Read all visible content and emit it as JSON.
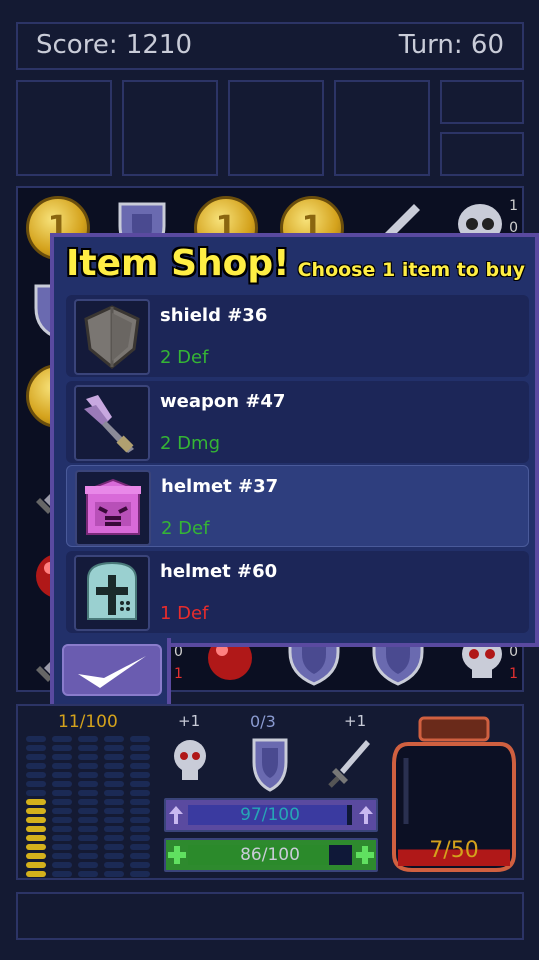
{
  "header": {
    "score": "Score: 1210",
    "turn": "Turn: 60"
  },
  "board": {
    "side_counts": [
      "1",
      "0",
      "0",
      "1",
      "0",
      "1"
    ]
  },
  "shop": {
    "title": "Item Shop!",
    "subtitle": "Choose 1 item to buy",
    "items": [
      {
        "name": "shield #36",
        "stat": "2 Def",
        "icon": "shield-icon",
        "stat_color": "green",
        "selected": false
      },
      {
        "name": "weapon #47",
        "stat": "2 Dmg",
        "icon": "sword-icon",
        "stat_color": "green",
        "selected": false
      },
      {
        "name": "helmet #37",
        "stat": "2 Def",
        "icon": "pink-helmet-icon",
        "stat_color": "green",
        "selected": true
      },
      {
        "name": "helmet #60",
        "stat": "1 Def",
        "icon": "cross-helmet-icon",
        "stat_color": "red",
        "selected": false
      }
    ],
    "confirm_icon": "checkmark-icon"
  },
  "stats": {
    "gold": "11/100",
    "gold_fraction": 0.11,
    "kill_bonus": "+1",
    "defense": "0/3",
    "attack_bonus": "+1",
    "xp": "97/100",
    "xp_fraction": 0.97,
    "hp": "86/100",
    "hp_fraction": 0.86,
    "potion": "7/50",
    "potion_fraction": 0.14
  },
  "colors": {
    "accent": "#ffee44",
    "good": "#35b535",
    "bad": "#e82c2c",
    "panel": "#22306a"
  }
}
